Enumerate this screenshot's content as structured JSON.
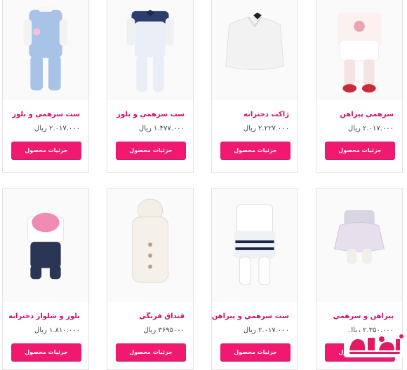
{
  "products": [
    {
      "title": "ست سرهمي و بلوز",
      "price": "۲.۰۱۷.۰۰۰ ريال",
      "button": "جزئيات محصول"
    },
    {
      "title": "ست سرهمي و بلوز",
      "price": "۱.۴۷۷.۰۰۰ ريال",
      "button": "جزئيات محصول"
    },
    {
      "title": "ژاکت دخترانه",
      "price": "۲.۲۲۷.۰۰۰ ريال",
      "button": "جزئيات محصول"
    },
    {
      "title": "سرهمي پيراهن",
      "price": "۲.۰۱۷.۰۰۰ ريال",
      "button": "جزئيات محصول"
    },
    {
      "title": "بلوز و شلوار دخترانه",
      "price": "۱.۸۱۰.۰۰۰ ريال",
      "button": "جزئيات محصول"
    },
    {
      "title": "قنداق فرنگي",
      "price": "۳۶۹۵۰۰۰ ريال",
      "button": "جزئيات محصول"
    },
    {
      "title": "ست سرهمي و پيراهن",
      "price": "۲.۰۱۷.۰۰۰ ريال",
      "button": "جزئيات محصول"
    },
    {
      "title": "پيراهن و سرهمي",
      "price": "۲.۳۵۰.۰۰۰ ريال",
      "button": "جزئيات محصول"
    }
  ],
  "logo": {
    "text": "بچانه"
  },
  "colors": {
    "accent": "#f0186f",
    "title": "#d10f6a"
  }
}
